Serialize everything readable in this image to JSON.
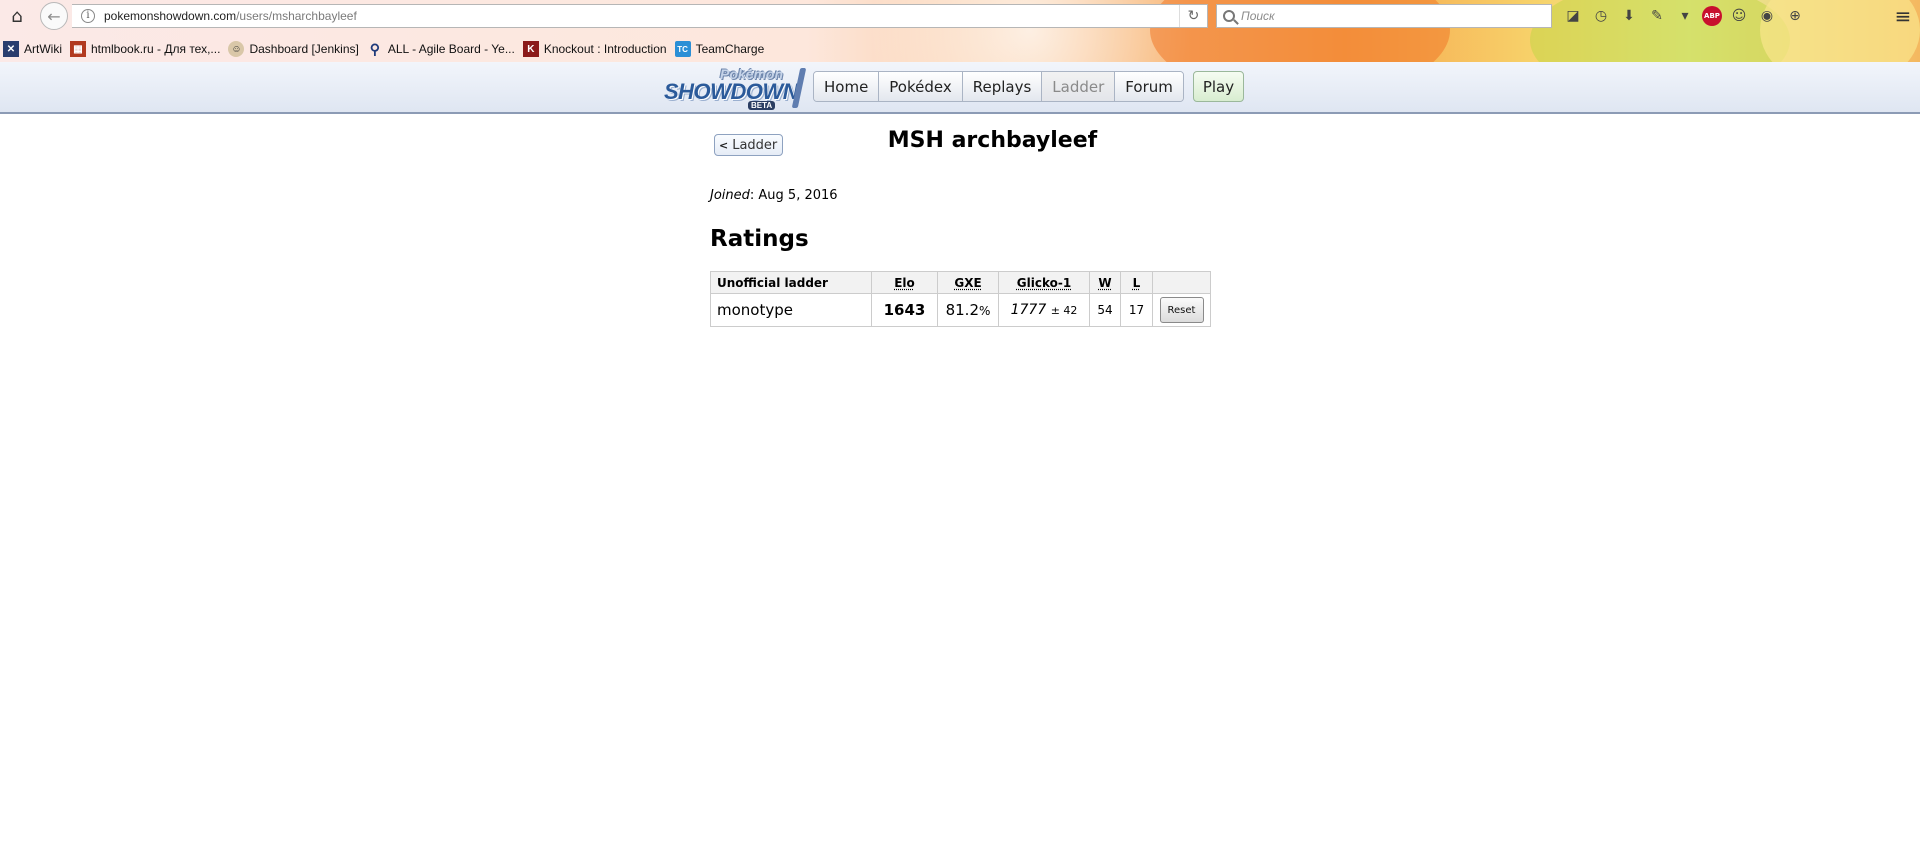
{
  "browser": {
    "url_domain": "pokemonshowdown.com",
    "url_path": "/users/msharchbayleef",
    "search_placeholder": "Поиск",
    "bookmarks": [
      {
        "label": "ArtWiki",
        "icon": "artwiki-icon"
      },
      {
        "label": "htmlbook.ru - Для тех,...",
        "icon": "htmlbook-icon"
      },
      {
        "label": "Dashboard [Jenkins]",
        "icon": "jenkins-icon"
      },
      {
        "label": "ALL - Agile Board - Ye...",
        "icon": "agile-icon"
      },
      {
        "label": "Knockout : Introduction",
        "icon": "knockout-icon"
      },
      {
        "label": "TeamCharge",
        "icon": "teamcharge-icon"
      }
    ],
    "abp_label": "ABP"
  },
  "site": {
    "logo": {
      "pokemon": "Pokémon",
      "showdown": "SHOWDOWN",
      "beta": "BETA"
    },
    "nav": [
      {
        "label": "Home",
        "current": false
      },
      {
        "label": "Pokédex",
        "current": false
      },
      {
        "label": "Replays",
        "current": false
      },
      {
        "label": "Ladder",
        "current": true
      },
      {
        "label": "Forum",
        "current": false
      }
    ],
    "play_label": "Play"
  },
  "profile": {
    "back_label": "Ladder",
    "username": "MSH archbayleef",
    "joined_label": "Joined",
    "joined_date": "Aug 5, 2016",
    "ratings_heading": "Ratings"
  },
  "ratings_table": {
    "headers": {
      "ladder": "Unofficial ladder",
      "elo": "Elo",
      "gxe": "GXE",
      "glicko": "Glicko-1",
      "w": "W",
      "l": "L"
    },
    "rows": [
      {
        "format": "monotype",
        "elo": "1643",
        "gxe_value": "81.2",
        "gxe_unit": "%",
        "glicko_rating": "1777",
        "glicko_deviation": "± 42",
        "w": "54",
        "l": "17",
        "reset_label": "Reset"
      }
    ]
  }
}
